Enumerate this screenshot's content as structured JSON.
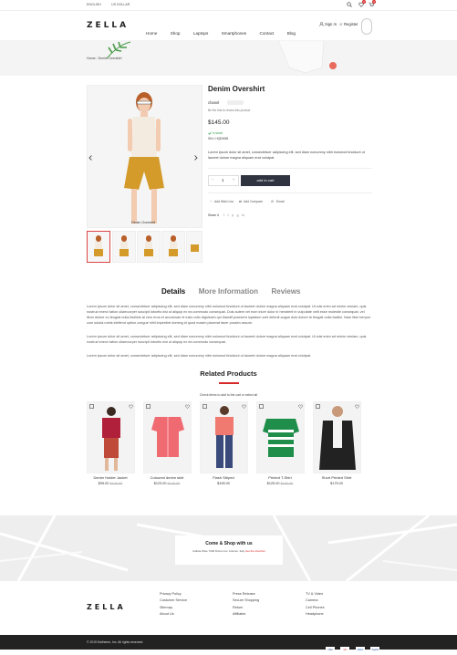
{
  "topbar": {
    "language": "ENGLISH",
    "currency": "US DOLLAR",
    "wishlist_count": "0",
    "cart_count": "0"
  },
  "brand": {
    "logo": "ZELLA"
  },
  "nav": {
    "items": [
      "Home",
      "Shop",
      "Laptops",
      "Smartphones",
      "Contact",
      "Blog"
    ]
  },
  "account": {
    "signin": "Sign In",
    "or": "or",
    "register": "Register"
  },
  "breadcrumb": {
    "home": "Home",
    "current": "Denim Overshirt"
  },
  "product": {
    "title": "Denim Overshirt",
    "brand": "chanel",
    "review_prompt": "Be the first to review this product",
    "price": "$145.00",
    "stock": "In stock",
    "sku": "SKU: HQE6655",
    "description": "Lorem ipsum dolor sit amet, consectetuer adipiscing elit, sed diam nonummy nibh euismod tincidunt ut laoreet dolore magna aliquam erat volutpat.",
    "quantity": "1",
    "add_to_cart": "add to cart",
    "wishlist": "Add Wish List",
    "compare": "Add Compare",
    "email": "Email",
    "share": "Share it",
    "image_caption": "Denim Overshirt"
  },
  "tabs": {
    "details": "Details",
    "more_info": "More Information",
    "reviews": "Reviews"
  },
  "details": {
    "p1": "Lorem ipsum dolor sit amet, consectetuer adipiscing elit, sed diam nonummy nibh euismod tincidunt ut laoreet dolore magna aliquam erat volutpat. Ut wisi enim ad minim veniam, quis nostrud exerci tation ullamcorper suscipit lobortis nisl ut aliquip ex ea commodo consequat. Duis autem vel eum iriure dolor in hendrerit in vulputate velit esse molestie consequat, vel illum dolore eu feugiat nulla facilisis at vero eros et accumsan et iusto odio dignissim qui blandit praesent luptatum zzril delenit augue duis dolore te feugait nulla facilisi. Nam liber tempor cum soluta nobis eleifend option congue nihil imperdiet doming id quod mazim placerat facer possim assum.",
    "p2": "Lorem ipsum dolor sit amet, consectetuer adipiscing elit, sed diam nonummy nibh euismod tincidunt ut laoreet dolore magna aliquam erat volutpat. Ut wisi enim ad minim veniam, quis nostrud exerci tation ullamcorper suscipit lobortis nisl ut aliquip ex ea commodo consequat.",
    "p3": "Lorem ipsum dolor sit amet, consectetuer adipiscing elit, sed diam nonummy nibh euismod tincidunt ut laoreet dolore magna aliquam erat volutpat."
  },
  "related": {
    "title": "Related Products",
    "check_text": "Check items to add to the cart or",
    "select_all": "select all",
    "products": [
      {
        "name": "Denim Holder Jacket",
        "price": "$95.00",
        "old_price": "$120.00"
      },
      {
        "name": "Coloured denim skirt",
        "price": "$123.00",
        "old_price": "$145.00"
      },
      {
        "name": "Flash Striped",
        "price": "$195.00",
        "old_price": ""
      },
      {
        "name": "Printed T-Shirt",
        "price": "$125.00",
        "old_price": "$150.00"
      },
      {
        "name": "Short Printed Shirt",
        "price": "$175.00",
        "old_price": ""
      }
    ]
  },
  "map_card": {
    "title": "Come & Shop with us",
    "address": "Calista Wise 7292 Dictum Av. Antonio, Italy",
    "link": "Get the direction"
  },
  "footer": {
    "logo": "ZELLA",
    "col1": [
      "Privacy Policy",
      "Customer Service",
      "Sitemap",
      "About Us"
    ],
    "col2": [
      "Press Release",
      "Secure Shopping",
      "Return",
      "Affiliates"
    ],
    "col3": [
      "TV & Video",
      "Camera",
      "Cell Phones",
      "Headphone"
    ],
    "copyright": "© 2019 Motheme, Inc. All rights reserved.",
    "payments": [
      "VISA",
      "MC",
      "AMEX",
      "PayPal"
    ]
  },
  "colors": {
    "accent": "#d62a2a",
    "dark_button": "#2f3440",
    "footer_bar": "#222222",
    "in_stock": "#2a9d4a"
  },
  "icons": [
    "search-icon",
    "heart-icon",
    "cart-icon",
    "user-icon",
    "chevron-left-icon",
    "chevron-right-icon",
    "check-icon"
  ]
}
